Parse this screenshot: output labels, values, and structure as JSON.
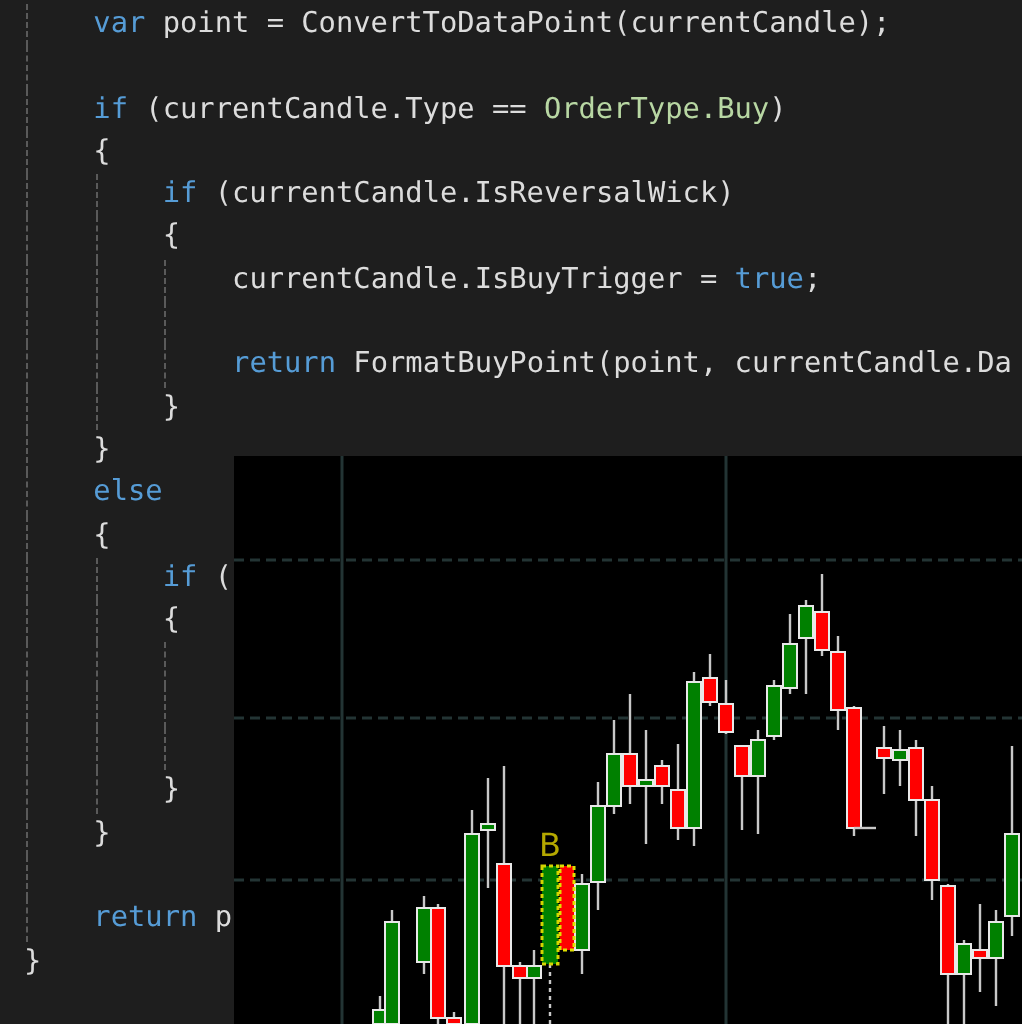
{
  "editor": {
    "lines": [
      {
        "kind": "group",
        "children": [
          {
            "kind": "code",
            "tokens": [
              {
                "kind": "keyword",
                "text": "var"
              },
              {
                "kind": "plain",
                "text": " point = ConvertToDataPoint(currentCandle);"
              }
            ]
          },
          {
            "kind": "blank"
          },
          {
            "kind": "code",
            "tokens": [
              {
                "kind": "keyword",
                "text": "if"
              },
              {
                "kind": "plain",
                "text": " (currentCandle.Type == "
              },
              {
                "kind": "enum",
                "text": "OrderType.Buy"
              },
              {
                "kind": "plain",
                "text": ")"
              }
            ]
          },
          {
            "kind": "code",
            "tokens": [
              {
                "kind": "plain",
                "text": "{"
              }
            ],
            "children": [
              {
                "kind": "code",
                "tokens": [
                  {
                    "kind": "keyword",
                    "text": "if"
                  },
                  {
                    "kind": "plain",
                    "text": " (currentCandle.IsReversalWick)"
                  }
                ]
              },
              {
                "kind": "code",
                "tokens": [
                  {
                    "kind": "plain",
                    "text": "{"
                  }
                ],
                "children": [
                  {
                    "kind": "code",
                    "tokens": [
                      {
                        "kind": "plain",
                        "text": "currentCandle.IsBuyTrigger = "
                      },
                      {
                        "kind": "keyword",
                        "text": "true"
                      },
                      {
                        "kind": "plain",
                        "text": ";"
                      }
                    ]
                  },
                  {
                    "kind": "blank"
                  },
                  {
                    "kind": "code",
                    "tokens": [
                      {
                        "kind": "keyword",
                        "text": "return"
                      },
                      {
                        "kind": "plain",
                        "text": " FormatBuyPoint(point, currentCandle.Da"
                      }
                    ]
                  }
                ]
              },
              {
                "kind": "code",
                "tokens": [
                  {
                    "kind": "plain",
                    "text": "}"
                  }
                ]
              }
            ]
          },
          {
            "kind": "code",
            "tokens": [
              {
                "kind": "plain",
                "text": "}"
              }
            ]
          },
          {
            "kind": "code",
            "tokens": [
              {
                "kind": "keyword",
                "text": "else"
              }
            ]
          },
          {
            "kind": "code",
            "tokens": [
              {
                "kind": "plain",
                "text": "{"
              }
            ],
            "children": [
              {
                "kind": "code",
                "tokens": [
                  {
                    "kind": "keyword",
                    "text": "if"
                  },
                  {
                    "kind": "plain",
                    "text": " ("
                  }
                ]
              },
              {
                "kind": "code",
                "tokens": [
                  {
                    "kind": "plain",
                    "text": "{"
                  }
                ],
                "children": [
                  {
                    "kind": "blank"
                  },
                  {
                    "kind": "blank"
                  },
                  {
                    "kind": "blank"
                  }
                ]
              },
              {
                "kind": "code",
                "tokens": [
                  {
                    "kind": "plain",
                    "text": "}"
                  }
                ]
              }
            ]
          },
          {
            "kind": "code",
            "tokens": [
              {
                "kind": "plain",
                "text": "}"
              }
            ]
          },
          {
            "kind": "blank"
          },
          {
            "kind": "code",
            "tokens": [
              {
                "kind": "keyword",
                "text": "return"
              },
              {
                "kind": "plain",
                "text": " p"
              }
            ]
          }
        ]
      },
      {
        "kind": "code",
        "tokens": [
          {
            "kind": "plain",
            "text": "}"
          }
        ]
      }
    ]
  },
  "chart": {
    "marker_label": "B"
  }
}
